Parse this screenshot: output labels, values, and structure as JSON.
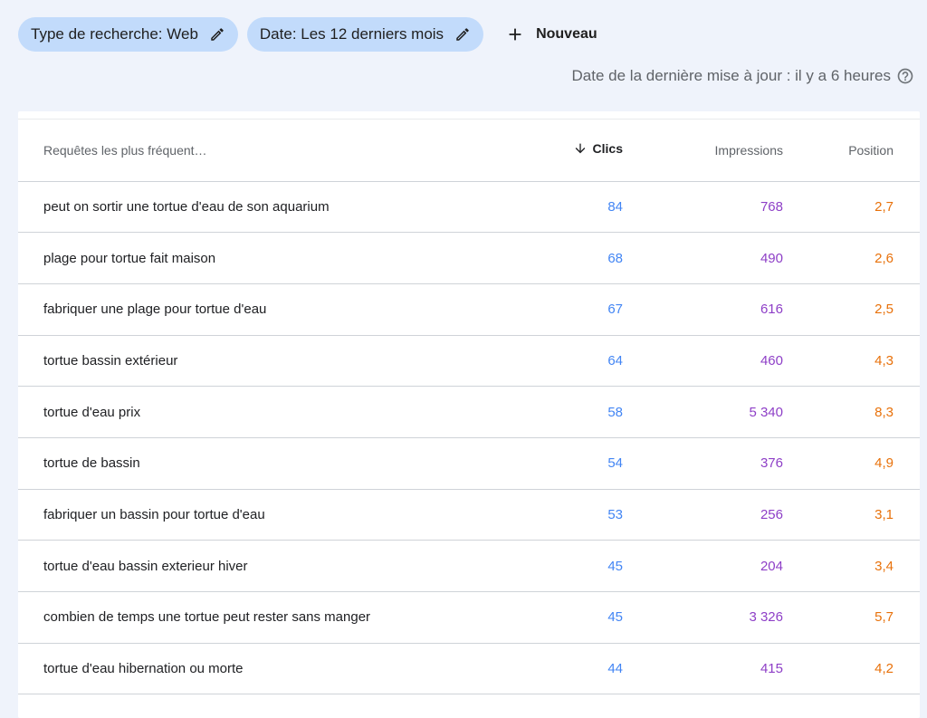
{
  "filters": {
    "search_type": "Type de recherche: Web",
    "date": "Date: Les 12 derniers mois",
    "new_label": "Nouveau"
  },
  "last_update": "Date de la dernière mise à jour : il y a 6 heures",
  "table": {
    "headers": {
      "query": "Requêtes les plus fréquent…",
      "clicks": "Clics",
      "impressions": "Impressions",
      "position": "Position"
    },
    "rows": [
      {
        "query": "peut on sortir une tortue d'eau de son aquarium",
        "clicks": "84",
        "impressions": "768",
        "position": "2,7"
      },
      {
        "query": "plage pour tortue fait maison",
        "clicks": "68",
        "impressions": "490",
        "position": "2,6"
      },
      {
        "query": "fabriquer une plage pour tortue d'eau",
        "clicks": "67",
        "impressions": "616",
        "position": "2,5"
      },
      {
        "query": "tortue bassin extérieur",
        "clicks": "64",
        "impressions": "460",
        "position": "4,3"
      },
      {
        "query": "tortue d'eau prix",
        "clicks": "58",
        "impressions": "5 340",
        "position": "8,3"
      },
      {
        "query": "tortue de bassin",
        "clicks": "54",
        "impressions": "376",
        "position": "4,9"
      },
      {
        "query": "fabriquer un bassin pour tortue d'eau",
        "clicks": "53",
        "impressions": "256",
        "position": "3,1"
      },
      {
        "query": "tortue d'eau bassin exterieur hiver",
        "clicks": "45",
        "impressions": "204",
        "position": "3,4"
      },
      {
        "query": "combien de temps une tortue peut rester sans manger",
        "clicks": "45",
        "impressions": "3 326",
        "position": "5,7"
      },
      {
        "query": "tortue d'eau hibernation ou morte",
        "clicks": "44",
        "impressions": "415",
        "position": "4,2"
      }
    ]
  },
  "colors": {
    "clicks": "#4285f4",
    "impressions": "#8e3fc7",
    "position": "#e8710a",
    "chip": "#c2dbfb"
  },
  "icons": {
    "edit": "pencil-icon",
    "add": "plus-icon",
    "help": "help-circle-icon",
    "sort": "arrow-down-icon"
  }
}
